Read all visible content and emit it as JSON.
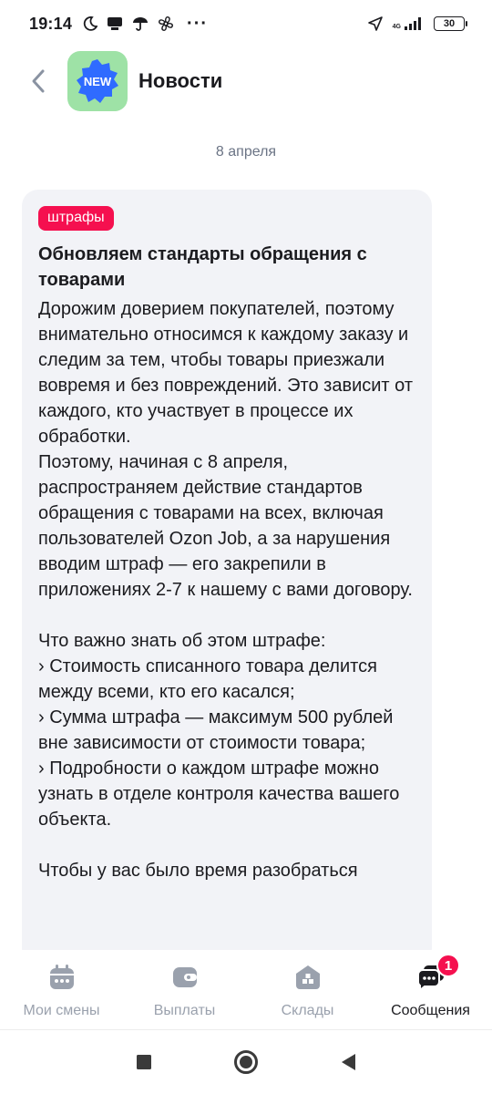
{
  "status_bar": {
    "time": "19:14",
    "network": "4G",
    "battery": "30"
  },
  "header": {
    "title": "Новости",
    "icon_text": "NEW"
  },
  "date": "8 апреля",
  "message": {
    "tag": "штрафы",
    "title": "Обновляем стандарты обращения с товарами",
    "body": "Дорожим доверием покупателей, поэтому внимательно относимся к каждому заказу и следим за тем, чтобы товары приезжали вовремя и без повреждений. Это зависит от каждого, кто участвует в процессе их обработки.\nПоэтому, начиная с 8 апреля, распространяем действие стандартов обращения с товарами на всех, включая пользователей Ozon Job, а за нарушения вводим штраф — его закрепили в приложениях 2-7 к нашему с вами договору.\n\nЧто важно знать об этом штрафе:\n› Стоимость списанного товара делится между всеми, кто его касался;\n› Сумма штрафа — максимум 500 рублей вне зависимости от стоимости товара;\n› Подробности о каждом штрафе можно узнать в отделе контроля качества вашего объекта.\n\nЧтобы у вас было время разобраться"
  },
  "bottom_nav": {
    "items": [
      {
        "label": "Мои смены",
        "icon": "calendar-icon"
      },
      {
        "label": "Выплаты",
        "icon": "wallet-icon"
      },
      {
        "label": "Склады",
        "icon": "warehouse-icon"
      },
      {
        "label": "Сообщения",
        "icon": "chat-icon",
        "badge": "1",
        "active": true
      }
    ]
  },
  "colors": {
    "accent": "#f5104f",
    "icon_bg": "#9ee2a6",
    "icon_badge": "#2f6bff",
    "card_bg": "#f2f3f7",
    "nav_inactive": "#9aa1ad",
    "nav_active": "#1b1b1f"
  }
}
